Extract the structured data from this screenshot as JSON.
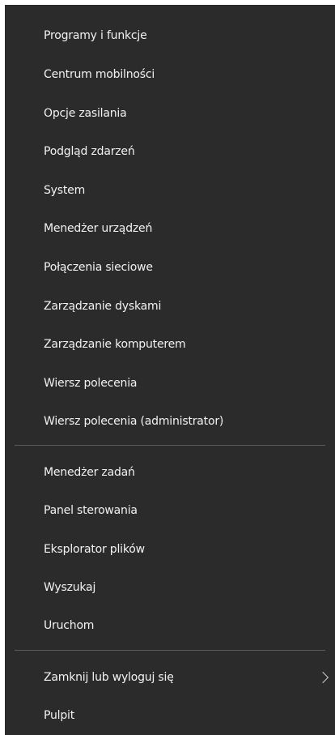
{
  "menu": {
    "group1": [
      {
        "label": "Programy i funkcje"
      },
      {
        "label": "Centrum mobilności"
      },
      {
        "label": "Opcje zasilania"
      },
      {
        "label": "Podgląd zdarzeń"
      },
      {
        "label": "System"
      },
      {
        "label": "Menedżer urządzeń"
      },
      {
        "label": "Połączenia sieciowe"
      },
      {
        "label": "Zarządzanie dyskami"
      },
      {
        "label": "Zarządzanie komputerem"
      },
      {
        "label": "Wiersz polecenia"
      },
      {
        "label": "Wiersz polecenia (administrator)"
      }
    ],
    "group2": [
      {
        "label": "Menedżer zadań"
      },
      {
        "label": "Panel sterowania"
      },
      {
        "label": "Eksplorator plików"
      },
      {
        "label": "Wyszukaj"
      },
      {
        "label": "Uruchom"
      }
    ],
    "group3": [
      {
        "label": "Zamknij lub wyloguj się",
        "submenu_icon": "chevron-right-icon"
      },
      {
        "label": "Pulpit"
      }
    ]
  },
  "colors": {
    "menu_background": "#2b2b2b",
    "text": "#f2f2f2",
    "separator": "#5a5a5a"
  }
}
